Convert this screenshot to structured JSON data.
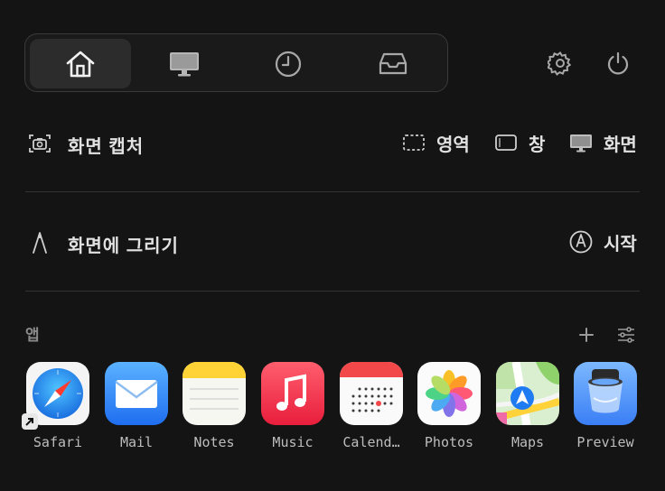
{
  "topbar": {
    "tabs": [
      {
        "id": "home",
        "icon": "home-icon",
        "active": true
      },
      {
        "id": "display",
        "icon": "monitor-icon",
        "active": false
      },
      {
        "id": "history",
        "icon": "clock-icon",
        "active": false
      },
      {
        "id": "inbox",
        "icon": "inbox-tray-icon",
        "active": false
      }
    ],
    "settings_icon": "gear-icon",
    "power_icon": "power-icon"
  },
  "capture": {
    "title": "화면 캡처",
    "options": [
      {
        "label": "영역",
        "icon": "region-dashed-icon"
      },
      {
        "label": "창",
        "icon": "window-icon"
      },
      {
        "label": "화면",
        "icon": "screen-monitor-icon"
      }
    ]
  },
  "draw": {
    "title": "화면에 그리기",
    "start_label": "시작"
  },
  "apps": {
    "label": "앱",
    "add_icon": "plus-icon",
    "settings_icon": "sliders-icon",
    "items": [
      {
        "name": "Safari"
      },
      {
        "name": "Mail"
      },
      {
        "name": "Notes"
      },
      {
        "name": "Music"
      },
      {
        "name": "Calend…"
      },
      {
        "name": "Photos"
      },
      {
        "name": "Maps"
      },
      {
        "name": "Preview"
      }
    ]
  },
  "colors": {
    "background": "#141414",
    "text": "#e2e2e2",
    "muted": "#8a8a8a",
    "divider": "#333333"
  }
}
